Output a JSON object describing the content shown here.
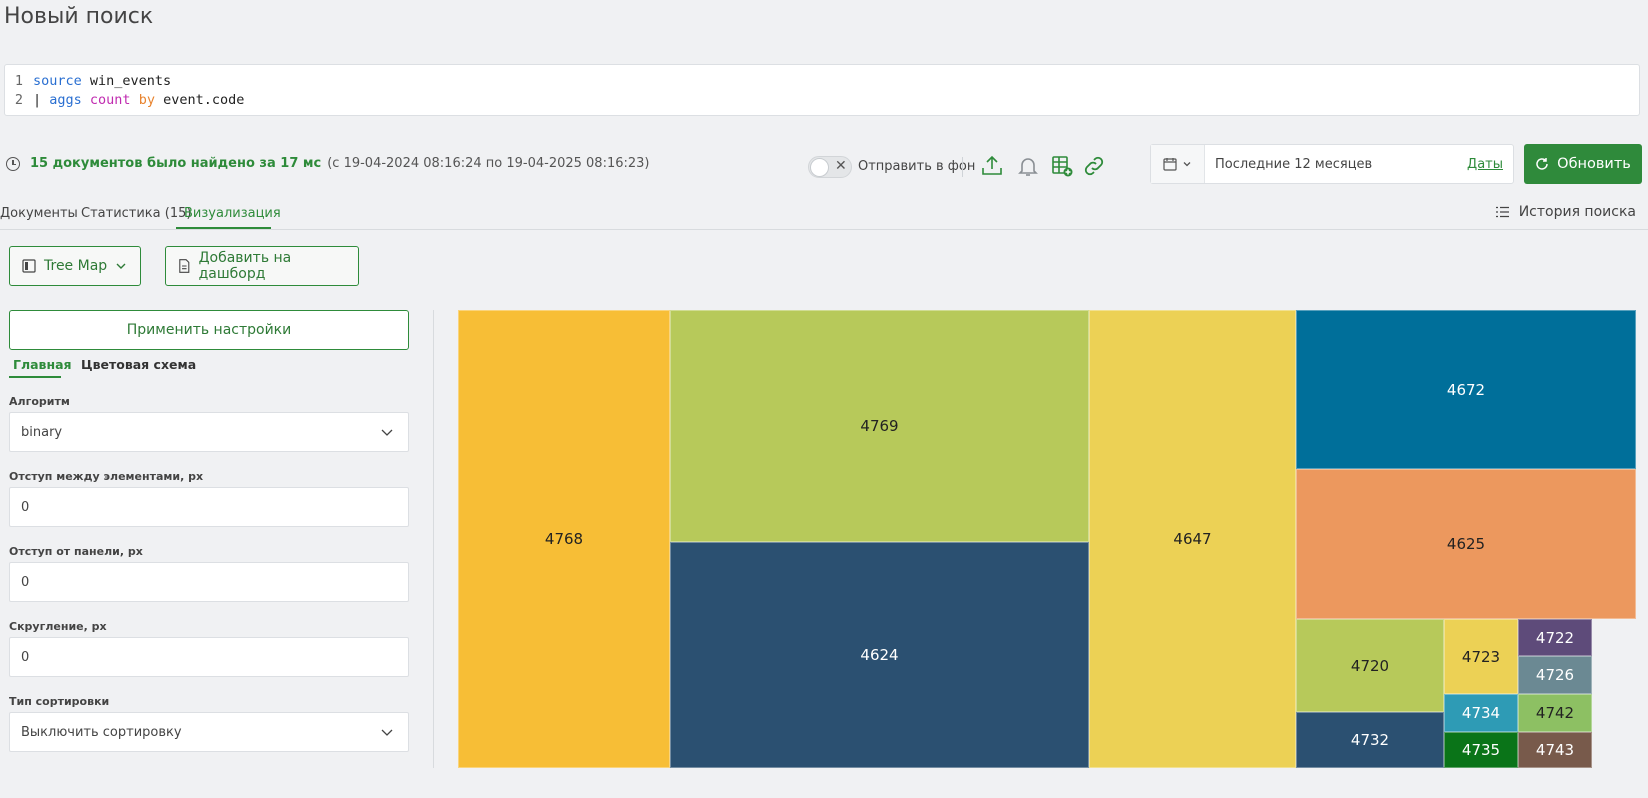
{
  "page": {
    "title": "Новый поиск"
  },
  "query": {
    "lines": [
      {
        "num": "1",
        "tokens": [
          {
            "t": "source",
            "c": "kw-blue"
          },
          {
            "t": " win_events",
            "c": "plain"
          }
        ]
      },
      {
        "num": "2",
        "tokens": [
          {
            "t": "| ",
            "c": "plain"
          },
          {
            "t": "aggs",
            "c": "kw-blue"
          },
          {
            "t": " ",
            "c": "plain"
          },
          {
            "t": "count",
            "c": "kw-pink"
          },
          {
            "t": " ",
            "c": "plain"
          },
          {
            "t": "by",
            "c": "kw-orange"
          },
          {
            "t": " event.code",
            "c": "plain"
          }
        ]
      }
    ]
  },
  "status": {
    "found": "15 документов было найдено за 17 мс",
    "range": "(с 19-04-2024 08:16:24 по 19-04-2025 08:16:23)"
  },
  "toolbar": {
    "send_background": "Отправить в фон",
    "date_range": "Последние 12 месяцев",
    "dates_link": "Даты",
    "refresh": "Обновить"
  },
  "tabs": {
    "documents": "Документы",
    "stats": "Статистика (15)",
    "viz": "Визуализация",
    "history": "История поиска"
  },
  "viz": {
    "type_button": "Tree Map",
    "add_dashboard": "Добавить на дашборд"
  },
  "settings": {
    "apply": "Применить настройки",
    "tab_main": "Главная",
    "tab_colors": "Цветовая схема",
    "algorithm_label": "Алгоритм",
    "algorithm_value": "binary",
    "padding_label": "Отступ между элементами, px",
    "padding_value": "0",
    "panel_padding_label": "Отступ от панели, px",
    "panel_padding_value": "0",
    "radius_label": "Скругление, px",
    "radius_value": "0",
    "sort_label": "Тип сортировки",
    "sort_value": "Выключить сортировку"
  },
  "chart_data": {
    "type": "treemap",
    "labels": [
      "4768",
      "4769",
      "4624",
      "4647",
      "4672",
      "4625",
      "4720",
      "4732",
      "4723",
      "4734",
      "4735",
      "4722",
      "4726",
      "4742",
      "4743"
    ],
    "colors": {
      "4768": "#f7be36",
      "4769": "#b7c95a",
      "4624": "#2b5071",
      "4647": "#ecd155",
      "4672": "#006f9a",
      "4625": "#ec985e",
      "4720": "#b7c95a",
      "4732": "#2b5071",
      "4723": "#ecd155",
      "4734": "#2e9bb5",
      "4735": "#0a7418",
      "4722": "#5e4b7a",
      "4726": "#6b8993",
      "4742": "#8dc063",
      "4743": "#785a4b"
    }
  }
}
